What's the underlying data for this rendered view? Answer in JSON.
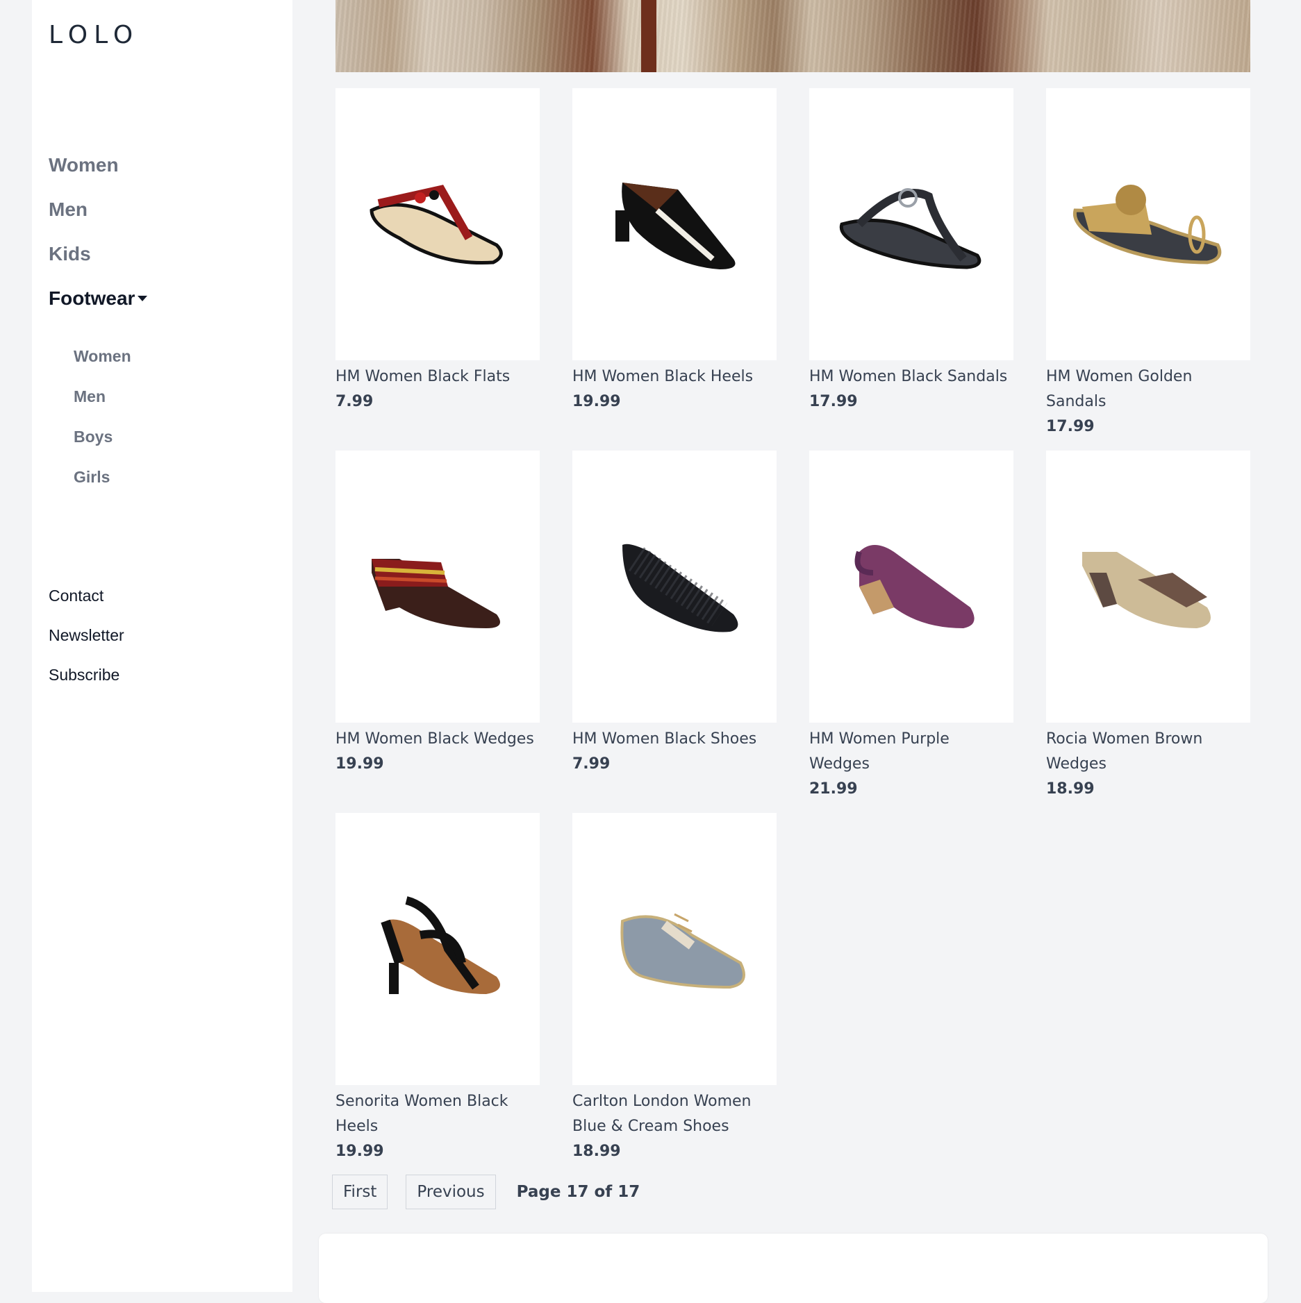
{
  "brand": {
    "logo": "LOLO"
  },
  "sidebar": {
    "main_nav": [
      {
        "label": "Women",
        "active": false
      },
      {
        "label": "Men",
        "active": false
      },
      {
        "label": "Kids",
        "active": false
      },
      {
        "label": "Footwear",
        "active": true
      }
    ],
    "sub_nav": [
      {
        "label": "Women"
      },
      {
        "label": "Men"
      },
      {
        "label": "Boys"
      },
      {
        "label": "Girls"
      }
    ],
    "footer_nav": [
      {
        "label": "Contact"
      },
      {
        "label": "Newsletter"
      },
      {
        "label": "Subscribe"
      }
    ]
  },
  "products": [
    {
      "name": "HM Women Black Flats",
      "price": "7.99",
      "icon": "flat-thong-sandal"
    },
    {
      "name": "HM Women Black Heels",
      "price": "19.99",
      "icon": "heeled-thong-sandal"
    },
    {
      "name": "HM Women Black Sandals",
      "price": "17.99",
      "icon": "flat-thong-sandal"
    },
    {
      "name": "HM Women Golden Sandals",
      "price": "17.99",
      "icon": "toe-ring-sandal"
    },
    {
      "name": "HM Women Black Wedges",
      "price": "19.99",
      "icon": "wedge-sandal"
    },
    {
      "name": "HM Women Black Shoes",
      "price": "7.99",
      "icon": "ballet-flat"
    },
    {
      "name": "HM Women Purple Wedges",
      "price": "21.99",
      "icon": "slingback-wedge"
    },
    {
      "name": "Rocia Women Brown Wedges",
      "price": "18.99",
      "icon": "wedge-mule"
    },
    {
      "name": "Senorita Women Black Heels",
      "price": "19.99",
      "icon": "strappy-heel"
    },
    {
      "name": "Carlton London Women Blue & Cream Shoes",
      "price": "18.99",
      "icon": "oxford-shoe"
    }
  ],
  "pagination": {
    "first_label": "First",
    "previous_label": "Previous",
    "page_info": "Page 17 of 17"
  },
  "colors": {
    "page_background": "#f3f4f6",
    "sidebar_background": "#ffffff",
    "text_primary": "#111827",
    "text_muted": "#6b7280"
  }
}
